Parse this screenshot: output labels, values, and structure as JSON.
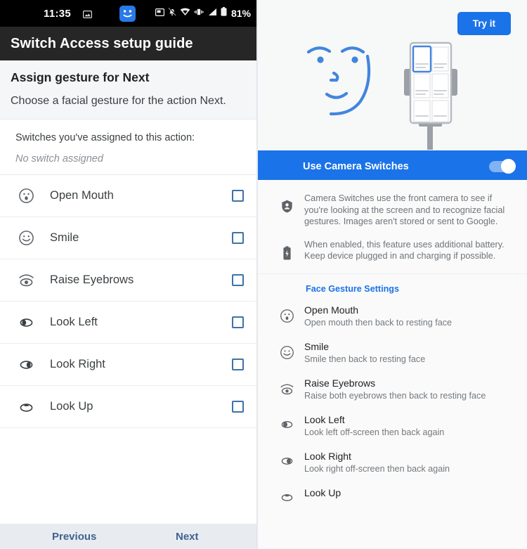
{
  "left": {
    "statusbar": {
      "time": "11:35",
      "battery_percent": "81%",
      "icons": [
        "message-icon",
        "face-switch-icon",
        "screenshot-icon",
        "notifications-muted-icon",
        "wifi-icon",
        "vibrate-icon",
        "signal-icon",
        "battery-icon"
      ]
    },
    "appbar": {
      "title": "Switch Access setup guide"
    },
    "intro": {
      "title": "Assign gesture for Next",
      "subtitle": "Choose a facial gesture for the action Next."
    },
    "assigned": {
      "label": "Switches you've assigned to this action:",
      "value": "No switch assigned"
    },
    "gestures": [
      {
        "label": "Open Mouth",
        "icon": "open-mouth-icon",
        "checked": false
      },
      {
        "label": "Smile",
        "icon": "smile-icon",
        "checked": false
      },
      {
        "label": "Raise Eyebrows",
        "icon": "raise-eyebrows-icon",
        "checked": false
      },
      {
        "label": "Look Left",
        "icon": "look-left-icon",
        "checked": false
      },
      {
        "label": "Look Right",
        "icon": "look-right-icon",
        "checked": false
      },
      {
        "label": "Look Up",
        "icon": "look-up-icon",
        "checked": false
      }
    ],
    "footer": {
      "previous": "Previous",
      "next": "Next"
    }
  },
  "right": {
    "hero": {
      "try_button": "Try it",
      "face_icon": "face-illustration",
      "phone_icon": "phone-on-stand-illustration"
    },
    "toggle": {
      "label": "Use Camera Switches",
      "on": true
    },
    "info": [
      {
        "icon": "privacy-shield-icon",
        "text": "Camera Switches use the front camera to see if you're looking at the screen and to recognize facial gestures. Images aren't stored or sent to Google."
      },
      {
        "icon": "battery-charging-icon",
        "text": "When enabled, this feature uses additional battery. Keep device plugged in and charging if possible."
      }
    ],
    "section_title": "Face Gesture Settings",
    "gestures": [
      {
        "title": "Open Mouth",
        "subtitle": "Open mouth then back to resting face",
        "icon": "open-mouth-icon"
      },
      {
        "title": "Smile",
        "subtitle": "Smile then back to resting face",
        "icon": "smile-icon"
      },
      {
        "title": "Raise Eyebrows",
        "subtitle": "Raise both eyebrows then back to resting face",
        "icon": "raise-eyebrows-icon"
      },
      {
        "title": "Look Left",
        "subtitle": "Look left off-screen then back again",
        "icon": "look-left-icon"
      },
      {
        "title": "Look Right",
        "subtitle": "Look right off-screen then back again",
        "icon": "look-right-icon"
      },
      {
        "title": "Look Up",
        "subtitle": "",
        "icon": "look-up-icon"
      }
    ]
  },
  "colors": {
    "accent": "#1a73e8",
    "appbar": "#262626",
    "statusbar": "#000000",
    "checkbox_border": "#3f72a8"
  }
}
